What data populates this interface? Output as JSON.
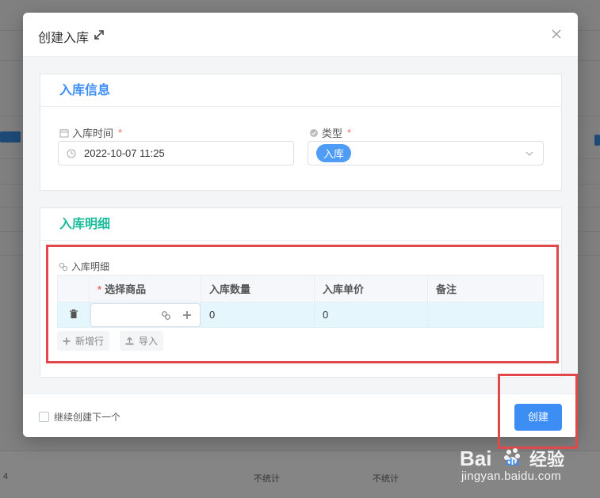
{
  "dialog": {
    "title": "创建入库",
    "expand_icon": "expand-icon",
    "close_icon": "close-icon"
  },
  "info_section": {
    "title": "入库信息",
    "title_color": "#3e8ef7",
    "time_label": "入库时间",
    "time_value": "2022-10-07 11:25",
    "type_label": "类型",
    "type_value": "入库",
    "required_mark": "*"
  },
  "detail_section": {
    "title": "入库明细",
    "title_color": "#1bbc9b",
    "sub_label": "入库明细",
    "columns": [
      "选择商品",
      "入库数量",
      "入库单价",
      "备注"
    ],
    "rows": [
      {
        "product": "",
        "quantity": "0",
        "price": "0",
        "note": ""
      }
    ],
    "add_row_label": "新增行",
    "import_label": "导入"
  },
  "footer": {
    "continue_label": "继续创建下一个",
    "continue_checked": false,
    "create_label": "创建",
    "create_color": "#3c8ef5"
  },
  "background": {
    "footer_items": [
      "4",
      "不统计",
      "不统计"
    ]
  },
  "watermark": {
    "text": "jingyan.baidu.com",
    "logo_text": "Bai",
    "logo_text2": "du",
    "logo_suffix": "经验"
  },
  "highlight_color": "#e0484a"
}
